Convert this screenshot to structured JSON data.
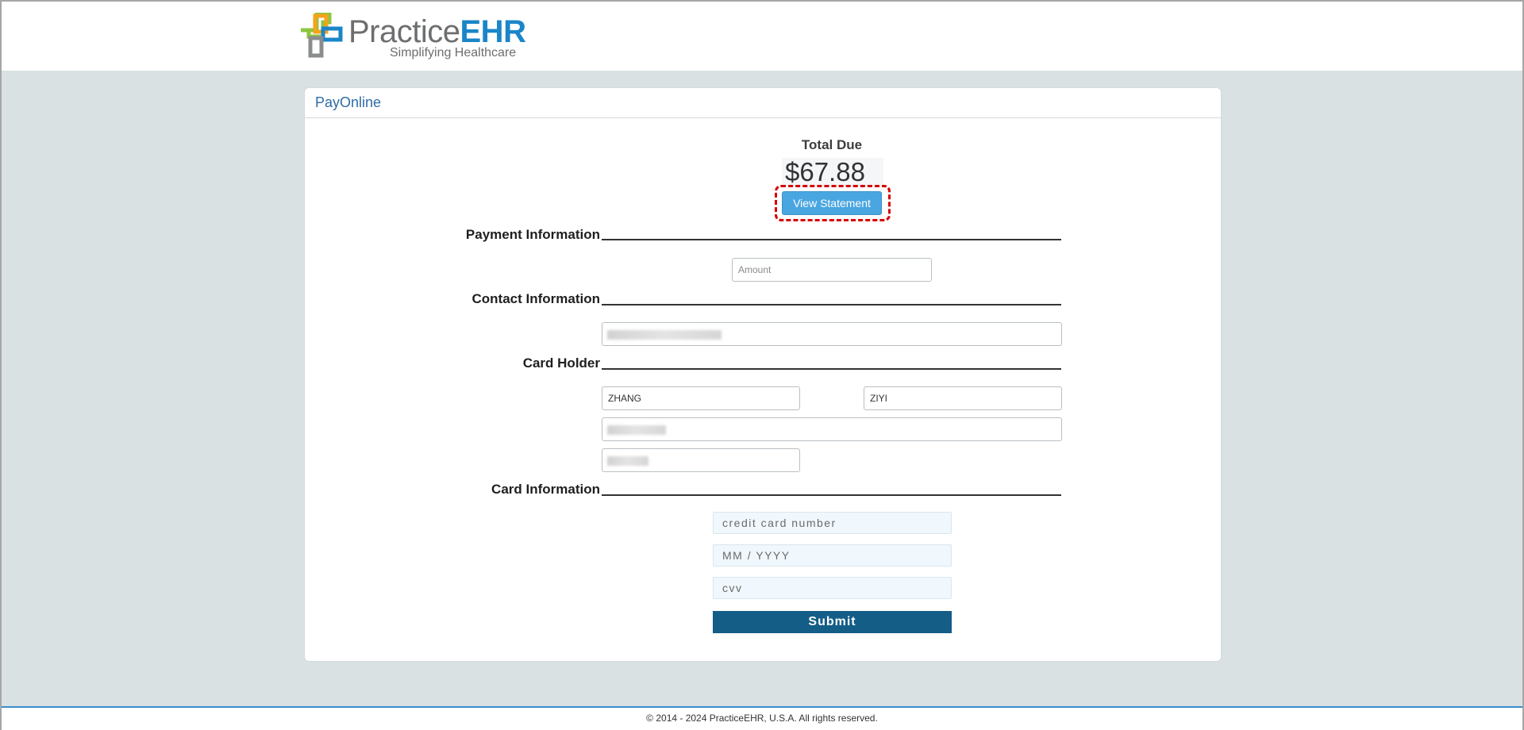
{
  "brand": {
    "name_part1": "Practice",
    "name_part2": "EHR",
    "tagline": "Simplifying Healthcare",
    "colors": {
      "green": "#8cc63f",
      "orange": "#f5a31a",
      "blue": "#1a86c8",
      "gray": "#8b8c8e"
    }
  },
  "panel": {
    "title": "PayOnline"
  },
  "summary": {
    "total_label": "Total Due",
    "total_amount": "$67.88",
    "view_statement_label": "View Statement"
  },
  "sections": {
    "payment": "Payment Information",
    "contact": "Contact Information",
    "card_holder": "Card Holder",
    "card_info": "Card Information"
  },
  "fields": {
    "amount_placeholder": "Amount",
    "last_name_value": "ZHANG",
    "first_name_value": "ZIYI",
    "card_number_placeholder": "credit card number",
    "expiry_placeholder": "MM / YYYY",
    "cvv_placeholder": "cvv"
  },
  "actions": {
    "submit_label": "Submit"
  },
  "footer": {
    "copyright": "© 2014 - 2024 PracticeEHR, U.S.A. All rights reserved."
  },
  "colors": {
    "accent": "#4aa6e0",
    "submit": "#135d87",
    "background": "#d9e1e3"
  }
}
